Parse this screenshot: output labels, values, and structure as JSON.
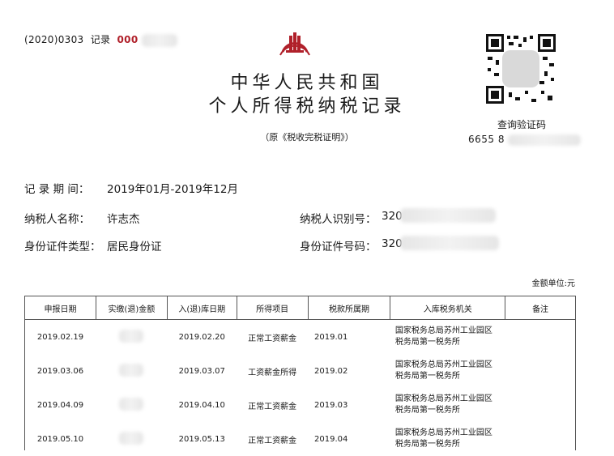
{
  "doc_number": {
    "prefix": "(2020)0303",
    "label": "记录",
    "num": "000"
  },
  "title_line1": "中华人民共和国",
  "title_line2": "个人所得税纳税记录",
  "subtitle": "（原《税收完税证明》）",
  "qr_label": "查询验证码",
  "verify_code": "6655 8",
  "record_period": {
    "label": "记 录 期 间：",
    "value": "2019年01月-2019年12月"
  },
  "taxpayer_name": {
    "label": "纳税人名称：",
    "value": "许志杰"
  },
  "taxpayer_id": {
    "label": "纳税人识别号：",
    "value": "320"
  },
  "id_type": {
    "label": "身份证件类型：",
    "value": "居民身份证"
  },
  "id_number": {
    "label": "身份证件号码：",
    "value": "320"
  },
  "unit": "金额单位:元",
  "table": {
    "headers": [
      "申报日期",
      "实缴(退)金额",
      "入(退)库日期",
      "所得项目",
      "税款所属期",
      "入库税务机关",
      "备注"
    ],
    "rows": [
      {
        "date": "2019.02.19",
        "amount": "",
        "entry_date": "2019.02.20",
        "item": "正常工资薪金",
        "period": "2019.01",
        "office_line1": "国家税务总局苏州工业园区",
        "office_line2": "税务局第一税务所",
        "remark": ""
      },
      {
        "date": "2019.03.06",
        "amount": "",
        "entry_date": "2019.03.07",
        "item": "工资薪金所得",
        "period": "2019.02",
        "office_line1": "国家税务总局苏州工业园区",
        "office_line2": "税务局第一税务所",
        "remark": ""
      },
      {
        "date": "2019.04.09",
        "amount": "",
        "entry_date": "2019.04.10",
        "item": "正常工资薪金",
        "period": "2019.03",
        "office_line1": "国家税务总局苏州工业园区",
        "office_line2": "税务局第一税务所",
        "remark": ""
      },
      {
        "date": "2019.05.10",
        "amount": "",
        "entry_date": "2019.05.13",
        "item": "正常工资薪金",
        "period": "2019.04",
        "office_line1": "国家税务总局苏州工业园区",
        "office_line2": "税务局第一税务所",
        "remark": ""
      }
    ]
  },
  "colors": {
    "red": "#b0202a",
    "border": "#555555"
  }
}
